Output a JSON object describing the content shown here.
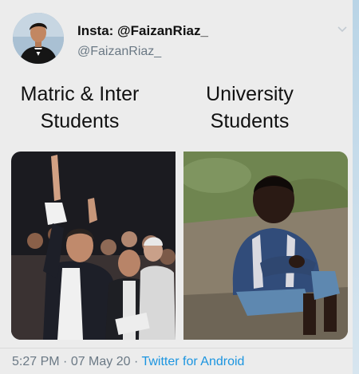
{
  "tweet": {
    "display_name": "Insta: @FaizanRiaz_",
    "handle": "@FaizanRiaz_",
    "menu_icon": "chevron-down-icon",
    "labels": {
      "left": [
        "Matric & Inter",
        "Students"
      ],
      "right": [
        "University",
        "Students"
      ]
    },
    "footer": {
      "time": "5:27 PM",
      "date": "07 May 20",
      "separator": " · ",
      "source": "Twitter for Android"
    },
    "colors": {
      "link": "#1b95e0",
      "secondary_text": "#6b7985",
      "primary_text": "#111111"
    }
  }
}
